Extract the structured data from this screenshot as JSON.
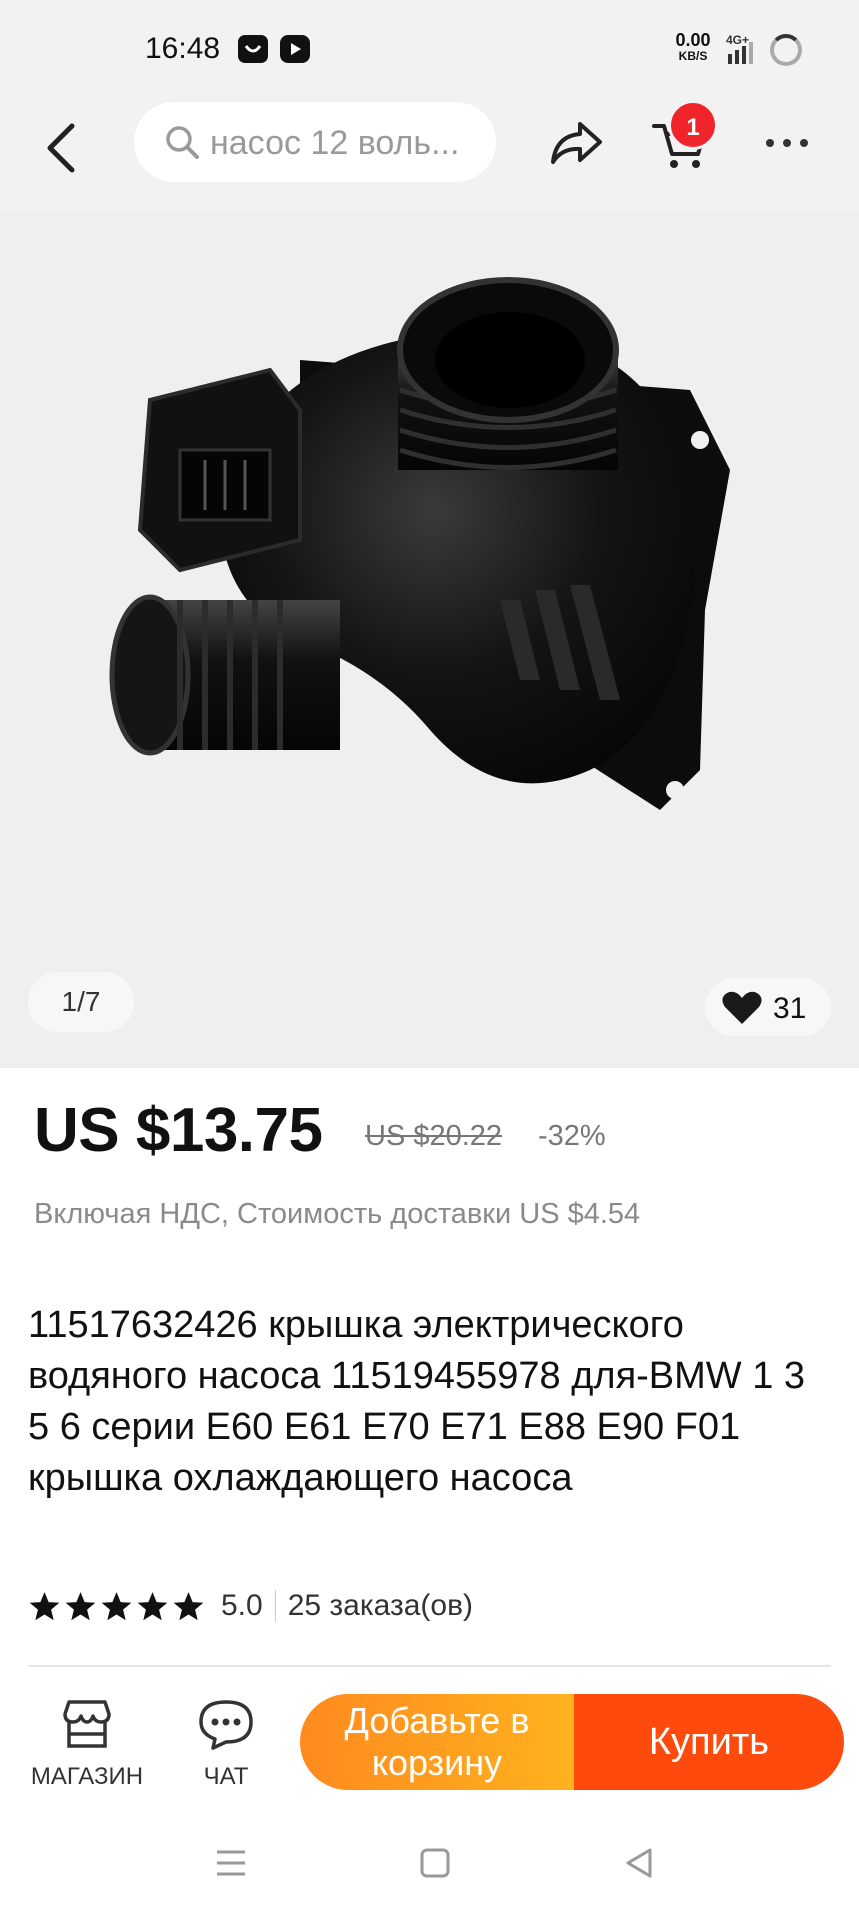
{
  "status_bar": {
    "time": "16:48",
    "net_speed_value": "0.00",
    "net_speed_unit": "KB/S",
    "network": "4G+"
  },
  "header": {
    "search_placeholder": "насос 12 воль...",
    "cart_count": "1"
  },
  "gallery": {
    "counter": "1/7",
    "likes": "31"
  },
  "price": {
    "current": "US $13.75",
    "original": "US $20.22",
    "discount": "-32%",
    "vat_shipping": "Включая НДС, Стоимость доставки US $4.54"
  },
  "product": {
    "title": "11517632426 крышка электрического водяного насоса 11519455978 для-BMW 1 3 5 6 серии E60 E61 E70 E71 E88 E90 F01 крышка охлаждающего насоса",
    "rating": "5.0",
    "stars": 5,
    "orders": "25 заказа(ов)"
  },
  "actions": {
    "store_label": "МАГАЗИН",
    "chat_label": "ЧАТ",
    "add_to_cart_label": "Добавьте в корзину",
    "buy_label": "Купить"
  },
  "colors": {
    "accent_orange": "#ff8a1e",
    "buy_red": "#ff4a0d",
    "badge_red": "#f0242b"
  }
}
